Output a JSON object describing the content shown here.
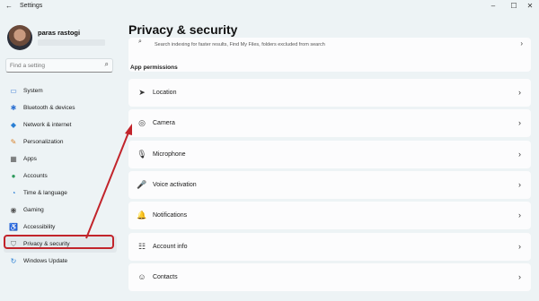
{
  "window": {
    "title": "Settings",
    "back_glyph": "←",
    "minimize": "–",
    "maximize": "☐",
    "close": "✕"
  },
  "user": {
    "name": "paras rastogi"
  },
  "search": {
    "placeholder": "Find a setting",
    "icon": "⌕"
  },
  "sidebar": {
    "items": [
      {
        "label": "System",
        "icon": "▭",
        "icon_color": "#3a7bd5"
      },
      {
        "label": "Bluetooth & devices",
        "icon": "✱",
        "icon_color": "#2b6fd1"
      },
      {
        "label": "Network & internet",
        "icon": "◆",
        "icon_color": "#2a7fd4"
      },
      {
        "label": "Personalization",
        "icon": "✎",
        "icon_color": "#d9822b"
      },
      {
        "label": "Apps",
        "icon": "▦",
        "icon_color": "#555555"
      },
      {
        "label": "Accounts",
        "icon": "●",
        "icon_color": "#2e9a5c"
      },
      {
        "label": "Time & language",
        "icon": "◔",
        "icon_color": "#2a7fd4"
      },
      {
        "label": "Gaming",
        "icon": "◉",
        "icon_color": "#555555"
      },
      {
        "label": "Accessibility",
        "icon": "♿",
        "icon_color": "#2a5fa8"
      },
      {
        "label": "Privacy & security",
        "icon": "⛉",
        "icon_color": "#6b6b6b"
      },
      {
        "label": "Windows Update",
        "icon": "↻",
        "icon_color": "#2a7fd4"
      }
    ],
    "active_index": 9
  },
  "main": {
    "title": "Privacy & security",
    "prev_card_text": "Search indexing for faster results, Find My Files, folders excluded from search",
    "prev_card_icon": "⌕",
    "section_title": "App permissions",
    "rows": [
      {
        "label": "Location",
        "icon": "➤"
      },
      {
        "label": "Camera",
        "icon": "◎"
      },
      {
        "label": "Microphone",
        "icon": "🎙"
      },
      {
        "label": "Voice activation",
        "icon": "🎤"
      },
      {
        "label": "Notifications",
        "icon": "🔔"
      },
      {
        "label": "Account info",
        "icon": "☷"
      },
      {
        "label": "Contacts",
        "icon": "☺"
      }
    ],
    "chevron": "›"
  },
  "annotation": {
    "color": "#c2242b"
  }
}
